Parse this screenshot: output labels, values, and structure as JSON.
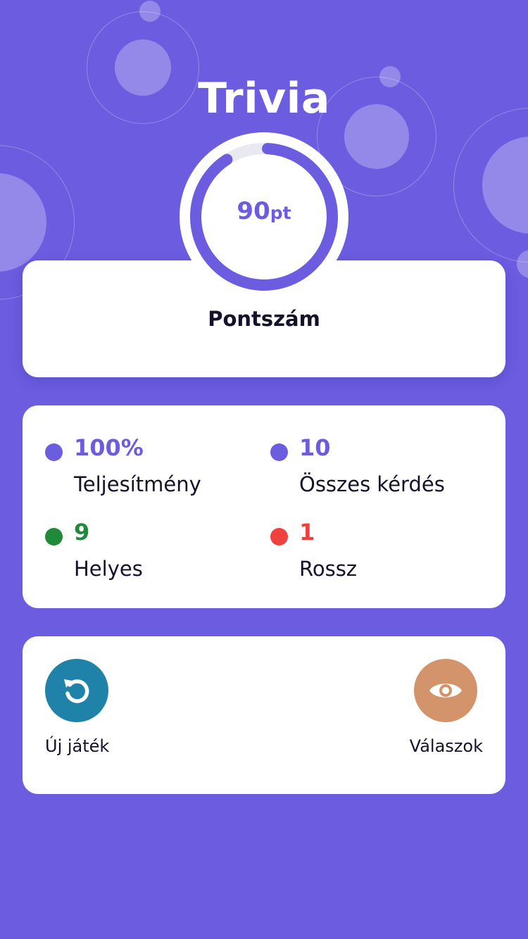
{
  "app": {
    "title": "Trivia"
  },
  "score": {
    "value": "90",
    "unit": "pt",
    "label": "Pontszám",
    "progress_fraction": 0.9
  },
  "stats": [
    {
      "value": "100%",
      "label": "Teljesítmény",
      "color": "#6b5ce0"
    },
    {
      "value": "10",
      "label": "Összes kérdés",
      "color": "#6b5ce0"
    },
    {
      "value": "9",
      "label": "Helyes",
      "color": "#1f8a3a"
    },
    {
      "value": "1",
      "label": "Rossz",
      "color": "#f0413f"
    }
  ],
  "actions": {
    "new_game": {
      "label": "Új játék",
      "icon": "restart-icon",
      "color": "#1f82a8"
    },
    "answers": {
      "label": "Válaszok",
      "icon": "eye-icon",
      "color": "#d4946b"
    }
  },
  "colors": {
    "background": "#6b5ce0",
    "accent": "#6b5ce0",
    "ring_track": "#e9e9f1",
    "text_dark": "#14122b"
  }
}
